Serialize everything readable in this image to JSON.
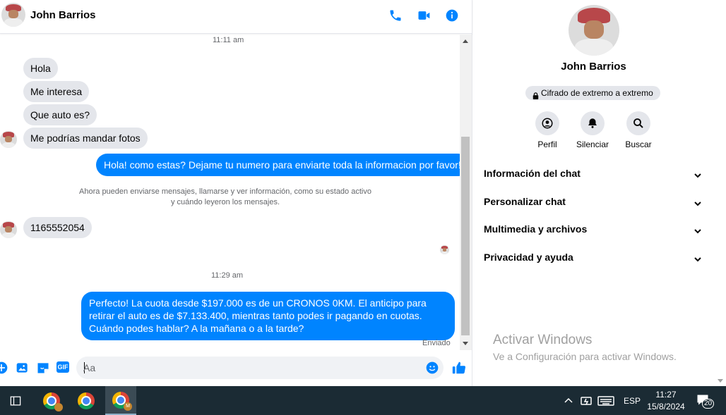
{
  "contact": {
    "name": "John Barrios"
  },
  "chat": {
    "messages": {
      "time1": "11:11 am",
      "m1": "Hola",
      "m2": "Me interesa",
      "m3": "Que auto es?",
      "m4": "Me podrías mandar fotos",
      "out1": "Hola! como estas? Dejame tu numero para enviarte toda la informacion por favor!",
      "system_line1": "Ahora pueden enviarse mensajes, llamarse y ver información, como su estado activo",
      "system_line2": "y cuándo leyeron los mensajes.",
      "m5": "1165552054",
      "time2": "11:29 am",
      "out2": "Perfecto! La cuota desde $197.000 es de un CRONOS 0KM. El anticipo para retirar el auto es de $7.133.400, mientras tanto podes ir pagando en cuotas. Cuándo podes hablar? A la mañana o a la tarde?",
      "sent_status": "Enviado"
    },
    "composer": {
      "placeholder": "Aa",
      "gif_label": "GIF"
    },
    "header_icons": [
      "phone-icon",
      "video-camera-icon",
      "info-icon"
    ],
    "accent_color": "#0084ff"
  },
  "info_panel": {
    "encryption_badge": "Cifrado de extremo a extremo",
    "actions": {
      "profile": "Perfil",
      "mute": "Silenciar",
      "search": "Buscar"
    },
    "sections": {
      "chat_info": "Información del chat",
      "customize": "Personalizar chat",
      "media": "Multimedia y archivos",
      "privacy": "Privacidad y ayuda"
    }
  },
  "watermark": {
    "title": "Activar Windows",
    "subtitle": "Ve a Configuración para activar Windows."
  },
  "taskbar": {
    "language": "ESP",
    "time": "11:27",
    "date": "15/8/2024",
    "chrome_badge": "M",
    "notifications_count": "20"
  }
}
